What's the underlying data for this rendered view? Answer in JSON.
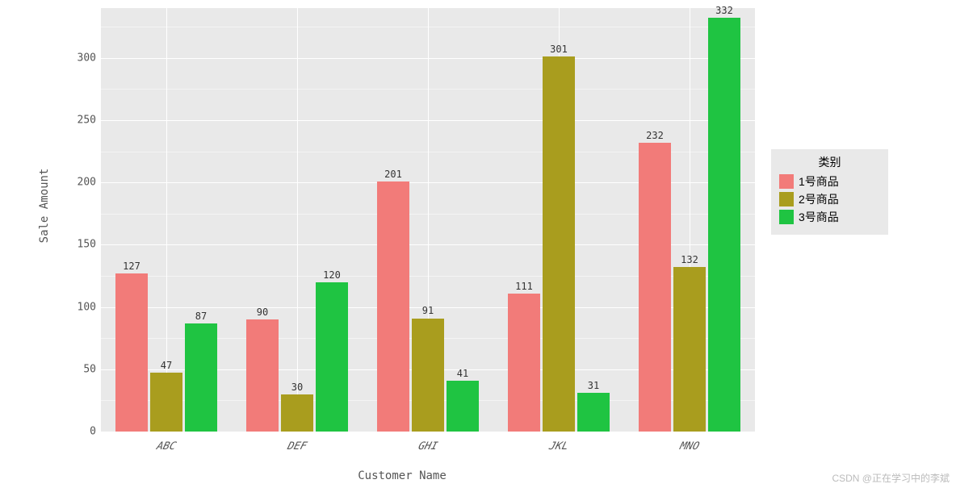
{
  "chart_data": {
    "type": "bar",
    "categories": [
      "ABC",
      "DEF",
      "GHI",
      "JKL",
      "MNO"
    ],
    "series": [
      {
        "name": "1号商品",
        "color": "#f27b79",
        "values": [
          127,
          90,
          201,
          111,
          232
        ]
      },
      {
        "name": "2号商品",
        "color": "#a99d1e",
        "values": [
          47,
          30,
          91,
          301,
          132
        ]
      },
      {
        "name": "3号商品",
        "color": "#1fc442",
        "values": [
          87,
          120,
          41,
          31,
          332
        ]
      }
    ],
    "xlabel": "Customer Name",
    "ylabel": "Sale Amount",
    "ylim": [
      0,
      340
    ],
    "yticks": [
      0,
      50,
      100,
      150,
      200,
      250,
      300
    ],
    "legend_title": "类别"
  },
  "watermark": "CSDN @正在学习中的李斌"
}
